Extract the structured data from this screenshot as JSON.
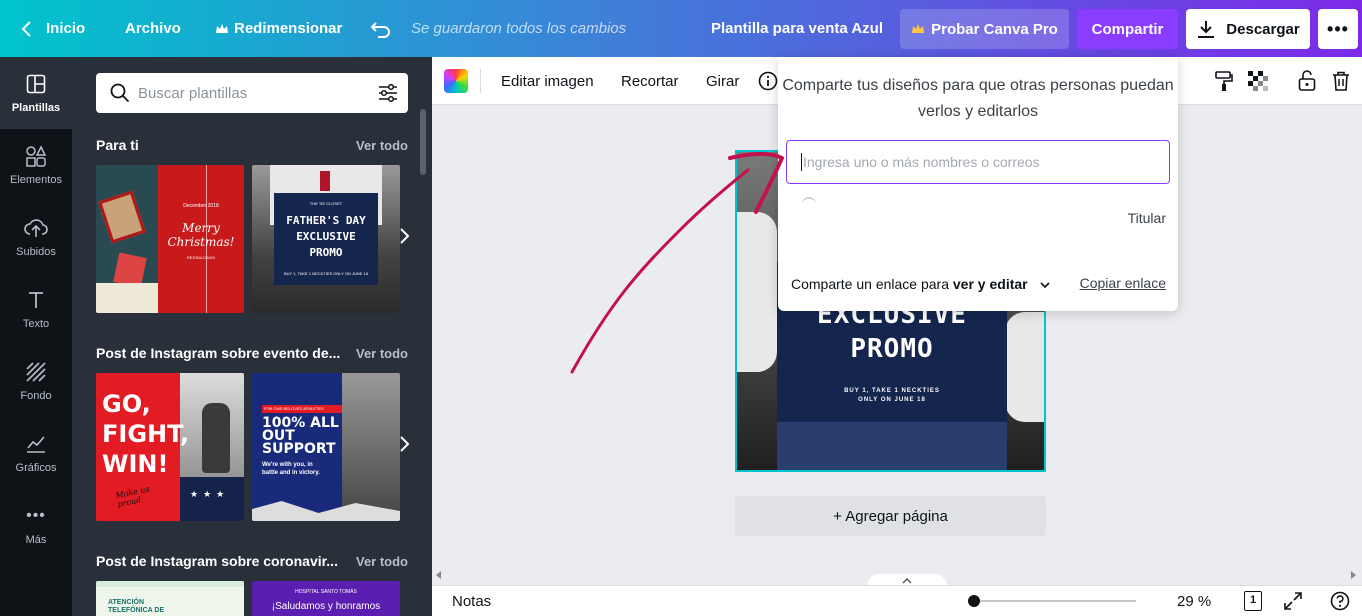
{
  "topbar": {
    "back_label": "Inicio",
    "file_label": "Archivo",
    "resize_label": "Redimensionar",
    "saved_status": "Se guardaron todos los cambios",
    "doc_title": "Plantilla para venta Azul",
    "try_pro_label": "Probar Canva Pro",
    "share_label": "Compartir",
    "download_label": "Descargar"
  },
  "rail": {
    "items": [
      {
        "label": "Plantillas",
        "icon": "templates-icon"
      },
      {
        "label": "Elementos",
        "icon": "elements-icon"
      },
      {
        "label": "Subidos",
        "icon": "upload-icon"
      },
      {
        "label": "Texto",
        "icon": "text-icon"
      },
      {
        "label": "Fondo",
        "icon": "background-icon"
      },
      {
        "label": "Gráficos",
        "icon": "charts-icon"
      },
      {
        "label": "Más",
        "icon": "more-icon"
      }
    ]
  },
  "panel": {
    "search_placeholder": "Buscar plantillas",
    "sections": [
      {
        "title": "Para ti",
        "more": "Ver todo"
      },
      {
        "title": "Post de Instagram sobre evento de...",
        "more": "Ver todo"
      },
      {
        "title": "Post de Instagram sobre coronavir...",
        "more": "Ver todo"
      }
    ],
    "thumbs": {
      "xmas_small": "December 2018",
      "xmas_title": "Merry Christmas!",
      "xmas_sub": "REGINA DAVIS",
      "fathers_top": "THE TIE CLOSET",
      "fathers_title": "FATHER'S DAY EXCLUSIVE PROMO",
      "fathers_sub": "BUY 1, TAKE 1 NECKTIES ONLY ON JUNE 18",
      "fight_title": "GO, FIGHT, WIN!",
      "fight_script": "Make us proud",
      "support_top": "FOR OUR BELOVED ATHLETES",
      "support_title": "100% ALL OUT SUPPORT",
      "support_body": "We're with you, in battle and in victory.",
      "covid1_title": "ATENCIÓN TELEFÓNICA DE",
      "covid2_top": "HOSPITAL SANTO TOMÁS",
      "covid2_title": "¡Saludamos y honramos"
    }
  },
  "toolbar": {
    "edit_image": "Editar imagen",
    "crop": "Recortar",
    "flip": "Girar"
  },
  "canvas": {
    "design_line1": "EXCLUSIVE",
    "design_line2": "PROMO",
    "design_sub1": "BUY 1, TAKE 1 NECKTIES",
    "design_sub2": "ONLY ON JUNE 18",
    "add_page": "+ Agregar página"
  },
  "share_popup": {
    "title": "Comparte tus diseños para que otras personas puedan verlos y editarlos",
    "input_placeholder": "Ingresa uno o más nombres o correos",
    "owner_role": "Titular",
    "link_prefix": "Comparte un enlace para",
    "link_permission": "ver y editar",
    "copy_link": "Copiar enlace"
  },
  "bottombar": {
    "notes_label": "Notas",
    "zoom": "29 %",
    "page_count": "1",
    "zoom_fraction": 0.0
  },
  "colors": {
    "accent_purple": "#8b3dff",
    "annotation": "#c4104f",
    "selection": "#00c4cc"
  }
}
